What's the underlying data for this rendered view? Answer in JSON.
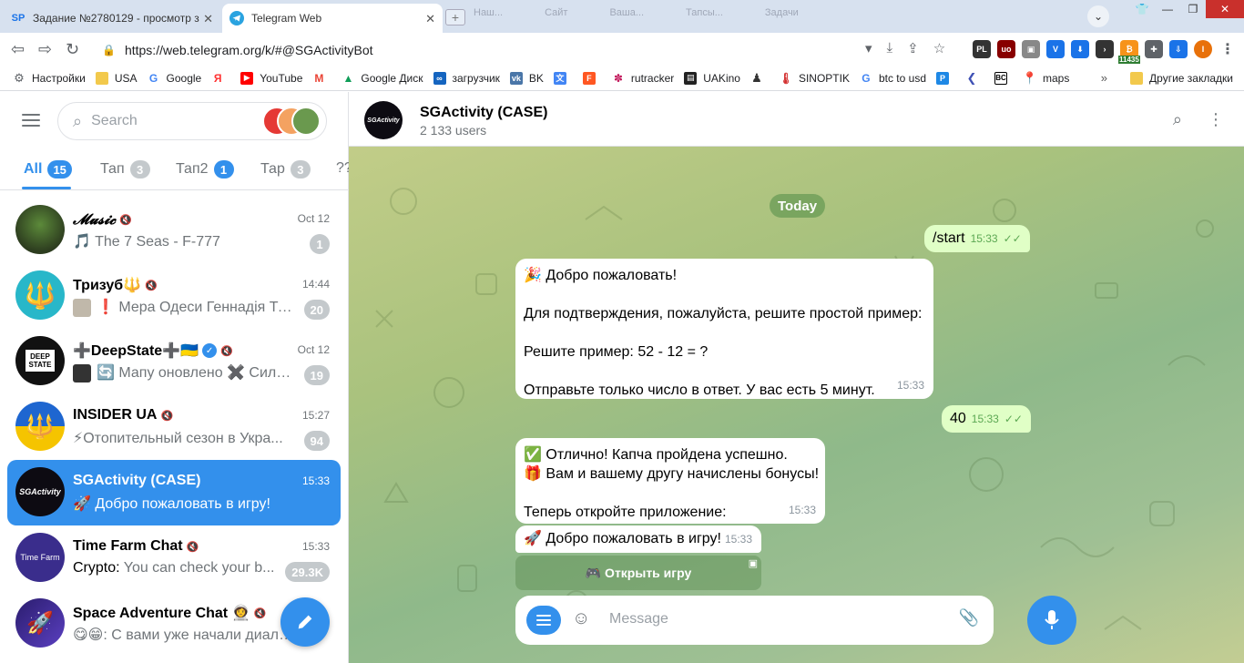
{
  "browser": {
    "tabs": [
      {
        "favicon": "SP",
        "title": "Задание №2780129 - просмотр з"
      },
      {
        "favicon": "telegram",
        "title": "Telegram Web"
      }
    ],
    "ghost_tabs": [
      "Наш...",
      "Сайт",
      "Ваша...",
      "Тапсы...",
      "Задачи"
    ],
    "url": "https://web.telegram.org/k/#@SGActivityBot",
    "extension_badge": "11435",
    "profile_initial": "I",
    "bookmarks": [
      "Настройки",
      "USA",
      "Google",
      "",
      "YouTube",
      "",
      "Google Диск",
      "загрузчик",
      "BK",
      "",
      "",
      "rutracker",
      "UAKino",
      "",
      "SINOPTIK",
      "btc to usd",
      "",
      "",
      "",
      "maps"
    ],
    "other_bookmarks": "Другие закладки"
  },
  "telegram": {
    "search_placeholder": "Search",
    "folders": [
      {
        "label": "All",
        "count": "15"
      },
      {
        "label": "Тап",
        "count": "3"
      },
      {
        "label": "Тап2",
        "count": "1"
      },
      {
        "label": "Тар",
        "count": "3"
      },
      {
        "label": "??",
        "count": ""
      }
    ],
    "chats": [
      {
        "name": "𝓜𝓾𝓼𝓲𝓬",
        "time": "Oct 12",
        "message": "🎵 The 7 Seas - F-777",
        "unread": "1"
      },
      {
        "name": "Тризуб🔱",
        "time": "14:44",
        "message": "❗ Мера Одеси Геннадія Тр...",
        "unread": "20"
      },
      {
        "name": "➕DeepState➕🇺🇦",
        "time": "Oct 12",
        "message": "🔄 Мапу оновлено ✖️ Сили...",
        "unread": "19"
      },
      {
        "name": "INSIDER UA",
        "time": "15:27",
        "message": "⚡Отопительный сезон в Укра...",
        "unread": "94"
      },
      {
        "name": "SGActivity (CASE)",
        "time": "15:33",
        "message": "🚀 Добро пожаловать в игру!",
        "unread": ""
      },
      {
        "name": "Time Farm Chat",
        "time": "15:33",
        "sender": "Crypto:",
        "message": "You can check your b...",
        "unread": "29.3K"
      },
      {
        "name": "Space Adventure Chat 👩‍🚀",
        "time": "",
        "message": "😋😁: С вами уже начали диало...",
        "unread": ""
      }
    ],
    "header": {
      "title": "SGActivity (CASE)",
      "subtitle": "2 133 users"
    },
    "date_label": "Today",
    "messages": {
      "m1": {
        "text": "/start",
        "time": "15:33"
      },
      "m2": {
        "lines": [
          "🎉 Добро пожаловать!",
          "",
          "Для подтверждения, пожалуйста, решите простой пример:",
          "",
          "Решите пример: 52 - 12 = ?",
          "",
          "Отправьте только число в ответ. У вас есть 5 минут."
        ],
        "time": "15:33"
      },
      "m3": {
        "text": "40",
        "time": "15:33"
      },
      "m4": {
        "lines": [
          "✅ Отлично! Капча пройдена успешно.",
          "🎁 Вам и вашему другу начислены бонусы!",
          "",
          "Теперь откройте приложение:"
        ],
        "time": "15:33"
      },
      "m5": {
        "text": "🚀 Добро пожаловать в игру!",
        "time": "15:33"
      }
    },
    "inline_button": "🎮 Открыть игру",
    "composer_placeholder": "Message"
  },
  "colors": {
    "accent": "#3390ec",
    "outgoing_bubble": "#e0ffc6"
  }
}
